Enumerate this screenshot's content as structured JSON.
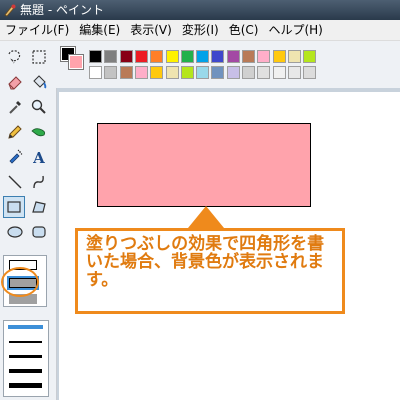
{
  "window": {
    "title": "無題 - ペイント",
    "icon": "paint-app-icon"
  },
  "menu": {
    "items": [
      "ファイル(F)",
      "編集(E)",
      "表示(V)",
      "変形(I)",
      "色(C)",
      "ヘルプ(H)"
    ]
  },
  "tools": [
    "free-select-icon",
    "rect-select-icon",
    "eraser-icon",
    "fill-bucket-icon",
    "color-picker-icon",
    "magnifier-icon",
    "pencil-icon",
    "brush-icon",
    "airbrush-icon",
    "text-icon",
    "line-icon",
    "curve-icon",
    "rectangle-icon",
    "polygon-icon",
    "ellipse-icon",
    "rounded-rect-icon"
  ],
  "active_tool": "rectangle-icon",
  "fill_style_options": [
    "outline-only",
    "outline-and-fill",
    "fill-only"
  ],
  "selected_fill_style": "outline-and-fill",
  "colors": {
    "foreground": "#000000",
    "background": "#ffa3ac",
    "palette_row1": [
      "#000000",
      "#7f7f7f",
      "#880015",
      "#ed1c24",
      "#ff7f27",
      "#fff200",
      "#22b14c",
      "#00a2e8",
      "#3f48cc",
      "#a349a4",
      "#b97a57",
      "#ffaec9",
      "#ffc90e",
      "#efe4b0",
      "#b5e61d"
    ],
    "palette_row2": [
      "#ffffff",
      "#c3c3c3",
      "#b97a57",
      "#ffaec9",
      "#ffc90e",
      "#efe4b0",
      "#b5e61d",
      "#99d9ea",
      "#7092be",
      "#c8bfe7",
      "#d0d0d0",
      "#e0e0e0",
      "#f0f0f0",
      "#e8e8e8",
      "#dcdcdc"
    ],
    "accent": "#ef8a1c",
    "rect_fill": "#ffa3ac"
  },
  "callout": {
    "text": "塗りつぶしの効果で四角形を書いた場合、背景色が表示されます。"
  }
}
